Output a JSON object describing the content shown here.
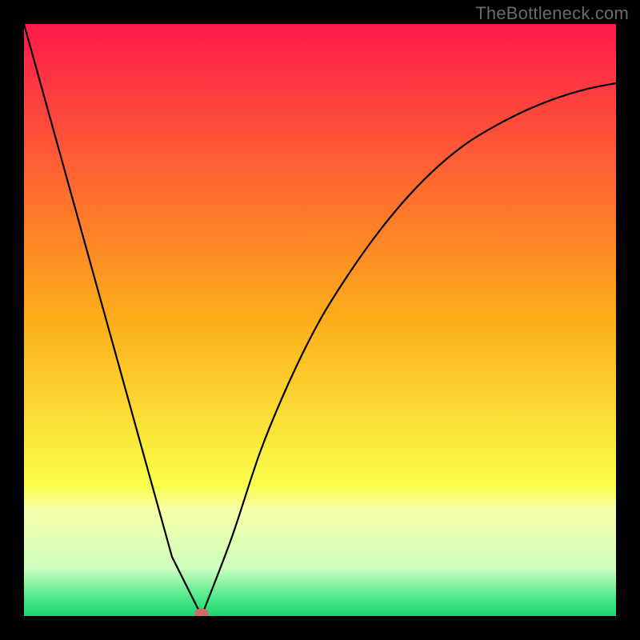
{
  "watermark": "TheBottleneck.com",
  "chart_data": {
    "type": "line",
    "title": "",
    "xlabel": "",
    "ylabel": "",
    "xlim": [
      0,
      100
    ],
    "ylim": [
      0,
      100
    ],
    "grid": false,
    "legend": false,
    "annotations": [],
    "series": [
      {
        "name": "curve",
        "x": [
          0,
          5,
          10,
          15,
          20,
          25,
          30,
          35,
          40,
          45,
          50,
          55,
          60,
          65,
          70,
          75,
          80,
          85,
          90,
          95,
          100
        ],
        "y": [
          100,
          82,
          64,
          46,
          28,
          10,
          0,
          13,
          28,
          40,
          50,
          58,
          65,
          71,
          76,
          80,
          83,
          85.5,
          87.5,
          89,
          90
        ]
      }
    ],
    "marker": {
      "x": 30,
      "y": 0,
      "color": "#cf6a67"
    },
    "background_gradient": {
      "stops": [
        {
          "pos": 0.0,
          "color": "#ff1a4b"
        },
        {
          "pos": 0.5,
          "color": "#fdae1a"
        },
        {
          "pos": 0.78,
          "color": "#f9ff4a"
        },
        {
          "pos": 0.82,
          "color": "#f7ffa8"
        },
        {
          "pos": 0.92,
          "color": "#cdffbe"
        },
        {
          "pos": 0.97,
          "color": "#4be88a"
        },
        {
          "pos": 1.0,
          "color": "#19d56d"
        }
      ]
    }
  }
}
